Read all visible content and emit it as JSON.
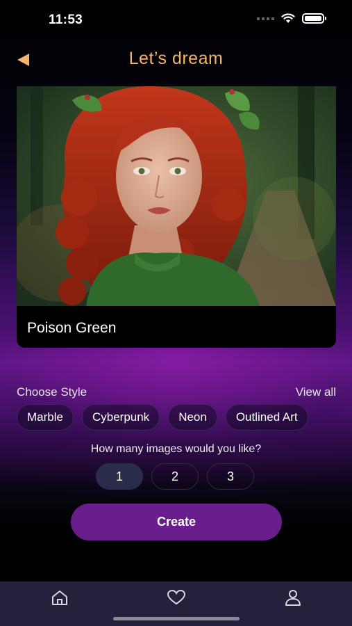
{
  "status_bar": {
    "time": "11:53"
  },
  "header": {
    "title": "Let’s dream",
    "back_icon": "back-arrow-icon"
  },
  "hero": {
    "caption": "Poison Green",
    "image_subject": "portrait-image"
  },
  "styles": {
    "heading": "Choose Style",
    "view_all": "View all",
    "chips": [
      "Marble",
      "Cyberpunk",
      "Neon",
      "Outlined Art"
    ]
  },
  "image_count": {
    "question": "How many images would you like?",
    "options": [
      "1",
      "2",
      "3"
    ],
    "selected": "1"
  },
  "create_button": {
    "label": "Create"
  },
  "tab_bar": {
    "tabs": [
      "home-icon",
      "heart-icon",
      "profile-icon"
    ]
  },
  "colors": {
    "title": "#F4B56A",
    "accent_purple": "#6A1E8E",
    "tab_bar": "#24213D",
    "selected_chip": "#2A2D4A"
  }
}
